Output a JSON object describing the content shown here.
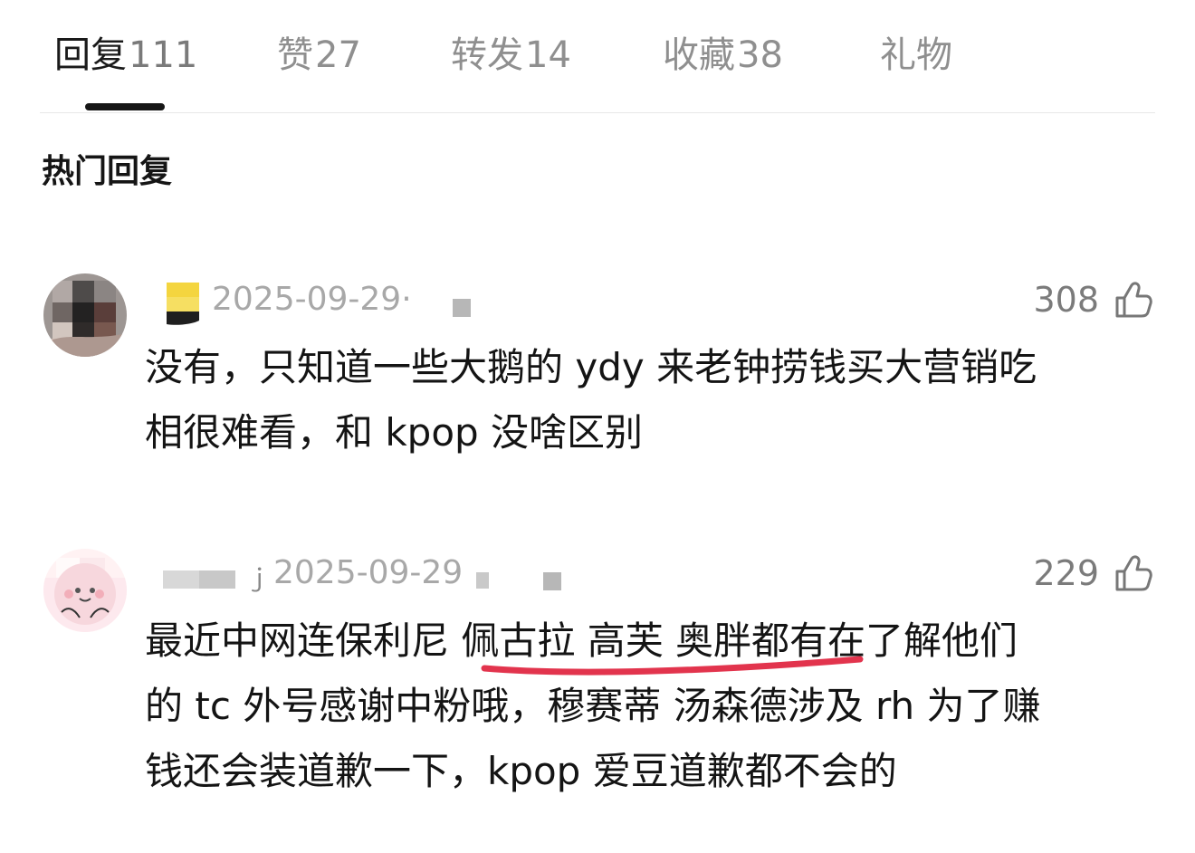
{
  "tabs": [
    {
      "label": "回复",
      "count": "111"
    },
    {
      "label": "赞",
      "count": "27"
    },
    {
      "label": "转发",
      "count": "14"
    },
    {
      "label": "收藏",
      "count": "38"
    },
    {
      "label": "礼物",
      "count": ""
    }
  ],
  "section_title": "热门回复",
  "comments": [
    {
      "time": "2025-09-29·",
      "likes": "308",
      "text_lines": [
        "没有，只知道一些大鹅的 ydy 来老钟捞钱买大营销吃",
        "相很难看，和 kpop 没啥区别"
      ]
    },
    {
      "time": "2025-09-29",
      "likes": "229",
      "text_lines": [
        "最近中网连保利尼 佩古拉 高芙 奥胖都有在了解他们",
        "的 tc 外号感谢中粉哦，穆赛蒂 汤森德涉及 rh 为了赚",
        "钱还会装道歉一下，kpop 爱豆道歉都不会的"
      ]
    }
  ],
  "colors": {
    "active_tab": "#1a1a1a",
    "inactive_tab": "#8f8f8f",
    "meta_text": "#a8a8a8",
    "like_count": "#7b7b7b",
    "underline_mark": "#e2344d"
  },
  "icons": {
    "like": "thumbs-up-icon"
  }
}
